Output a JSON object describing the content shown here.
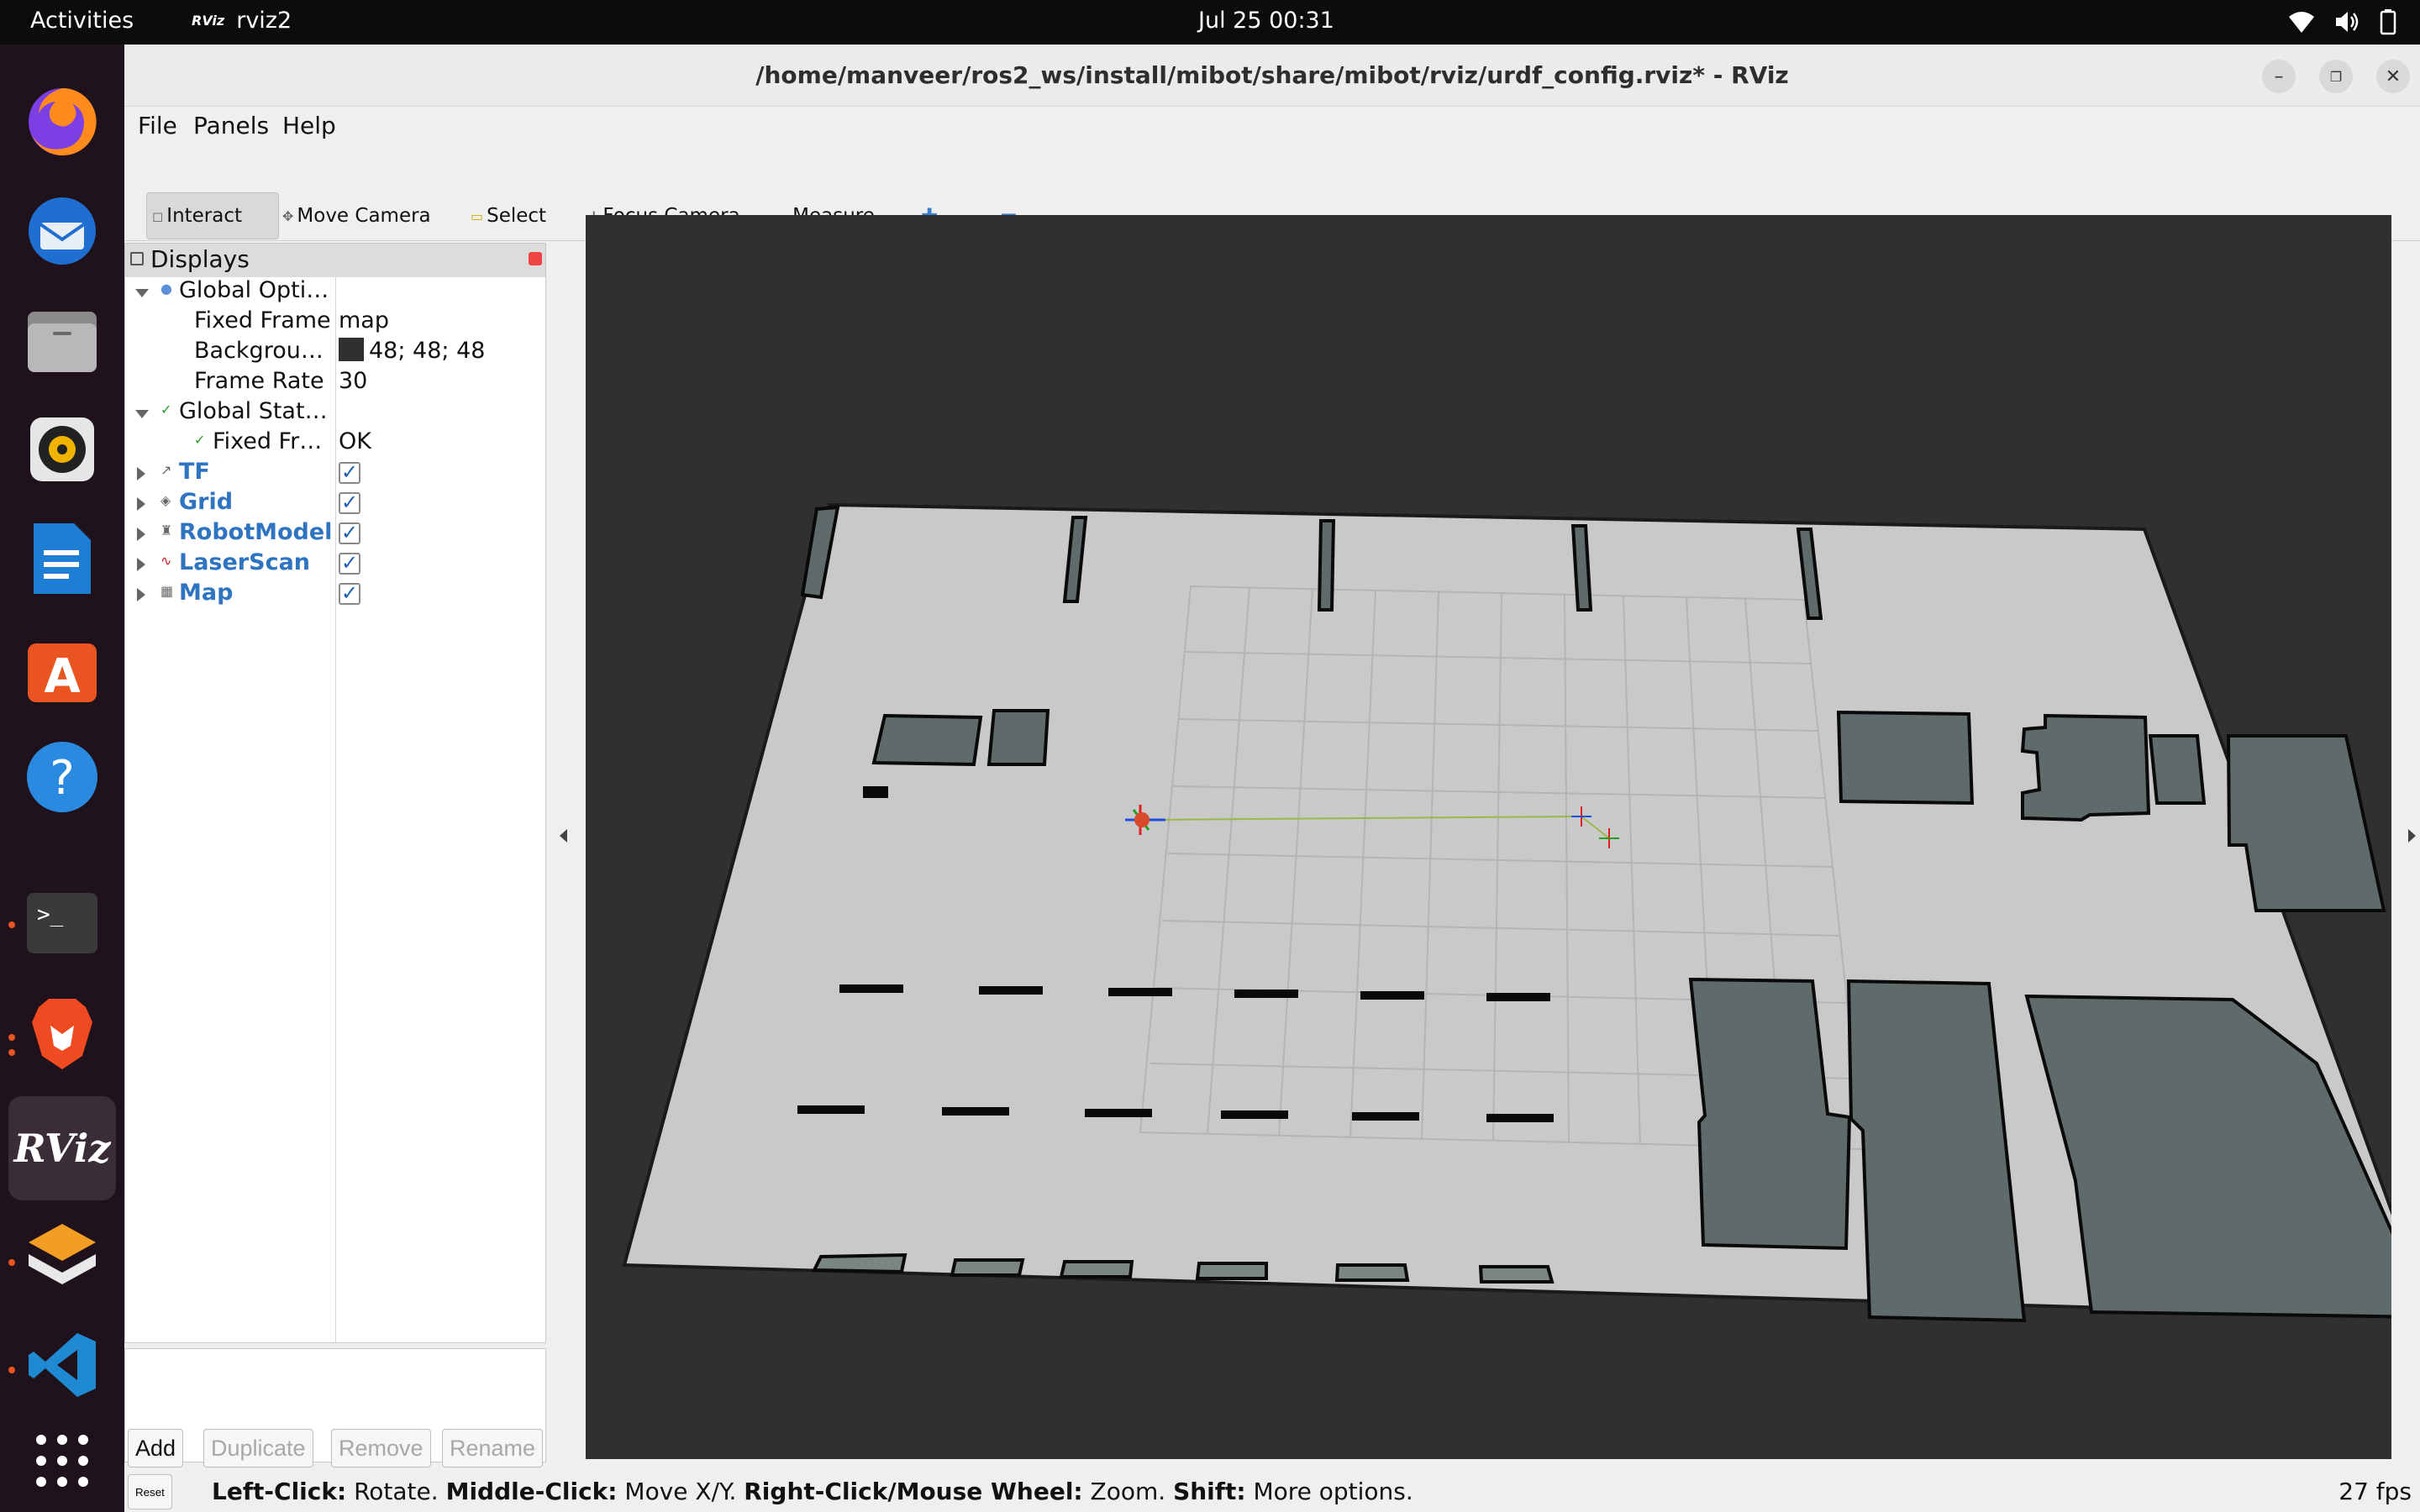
{
  "topbar": {
    "activities": "Activities",
    "app_name": "rviz2",
    "app_logo": "RViz",
    "clock": "Jul 25  00:31",
    "tray_icons": [
      "wifi-icon",
      "volume-icon",
      "battery-icon"
    ]
  },
  "dock": {
    "items": [
      "firefox",
      "thunderbird",
      "files",
      "rhythmbox",
      "libreoffice-writer",
      "app-center",
      "help",
      "terminal",
      "brave",
      "rviz",
      "sublime-merge",
      "vscode",
      "show-apps"
    ],
    "rviz_label": "RViz"
  },
  "window": {
    "title": "/home/manveer/ros2_ws/install/mibot/share/mibot/rviz/urdf_config.rviz* - RViz"
  },
  "menu": {
    "file": "File",
    "panels": "Panels",
    "help": "Help"
  },
  "toolbar": {
    "interact": "Interact",
    "move_camera": "Move Camera",
    "select": "Select",
    "focus_camera": "Focus Camera",
    "measure": "Measure"
  },
  "displays": {
    "title": "Displays",
    "global_options": "Global Opti…",
    "fixed_frame_label": "Fixed Frame",
    "fixed_frame_value": "map",
    "background_label": "Backgrou…",
    "background_value": "48; 48; 48",
    "frame_rate_label": "Frame Rate",
    "frame_rate_value": "30",
    "global_status": "Global Stat…",
    "fixed_frame_status_label": "Fixed Fr…",
    "fixed_frame_status_value": "OK",
    "items": [
      {
        "name": "TF",
        "checked": true
      },
      {
        "name": "Grid",
        "checked": true
      },
      {
        "name": "RobotModel",
        "checked": true
      },
      {
        "name": "LaserScan",
        "checked": true
      },
      {
        "name": "Map",
        "checked": true
      }
    ],
    "buttons": {
      "add": "Add",
      "duplicate": "Duplicate",
      "remove": "Remove",
      "rename": "Rename"
    }
  },
  "statusbar": {
    "reset": "Reset",
    "left_click": "Left-Click:",
    "left_click_text": "Rotate.",
    "middle_click": "Middle-Click:",
    "middle_click_text": "Move X/Y.",
    "right_click": "Right-Click/Mouse Wheel:",
    "right_click_text": "Zoom.",
    "shift": "Shift:",
    "shift_text": "More options.",
    "fps": "27 fps"
  },
  "colors": {
    "viewport_bg": "#303030",
    "map_free": "#c8c8c8",
    "map_unknown": "#5f6b6a",
    "map_occupied": "#0a0a0a",
    "accent_blue": "#2f74c0"
  }
}
